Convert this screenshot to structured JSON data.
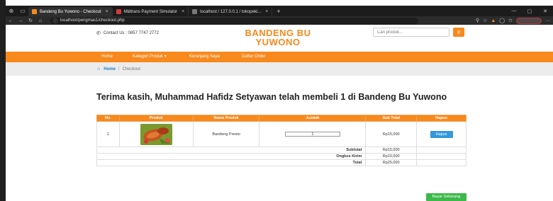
{
  "browser": {
    "tabs": [
      {
        "label": "Bandeng Bu Yuwono - Checkout",
        "active": true,
        "favicon_color": "#f7891d"
      },
      {
        "label": "Midtrans Payment Simulator",
        "active": false,
        "favicon_color": "#d43c3c"
      },
      {
        "label": "localhost / 127.0.0.1 / tokopeki...",
        "active": false,
        "favicon_color": "#777777"
      }
    ],
    "url": "localhost/pengmas1/checkout.php"
  },
  "header": {
    "contact": "Contact Us : 0857 7747 2772",
    "brand": "BANDENG BU YUWONO",
    "search_placeholder": "Cari produk..."
  },
  "nav": {
    "items": [
      "Home",
      "Kategori Produk ▾",
      "Keranjang Saya",
      "Daftar Order"
    ]
  },
  "breadcrumb": {
    "home": "Home",
    "separator": "/",
    "current": "Checkout"
  },
  "heading": "Terima kasih, Muhammad Hafidz Setyawan telah membeli 1 di Bandeng Bu Yuwono",
  "cart": {
    "headers": [
      "No.",
      "Produk",
      "Nama Produk",
      "Jumlah",
      "Sub Total",
      "Hapus"
    ],
    "items": [
      {
        "no": "1",
        "image": "bandeng-presto-image",
        "name": "Bandeng Presto",
        "qty": "1",
        "subtotal": "Rp15,000",
        "remove_label": "Hapus"
      }
    ],
    "summary": [
      {
        "label": "Subtotal",
        "value": "Rp15,000"
      },
      {
        "label": "Ongkos Kirim",
        "value": "Rp10,000"
      },
      {
        "label": "Total",
        "value": "Rp25,000"
      }
    ]
  },
  "pay_button": "Bayar Sekarang",
  "colors": {
    "accent": "#f7891d",
    "link": "#1a7bc1",
    "delete": "#3498db",
    "pay": "#3cb94a"
  }
}
